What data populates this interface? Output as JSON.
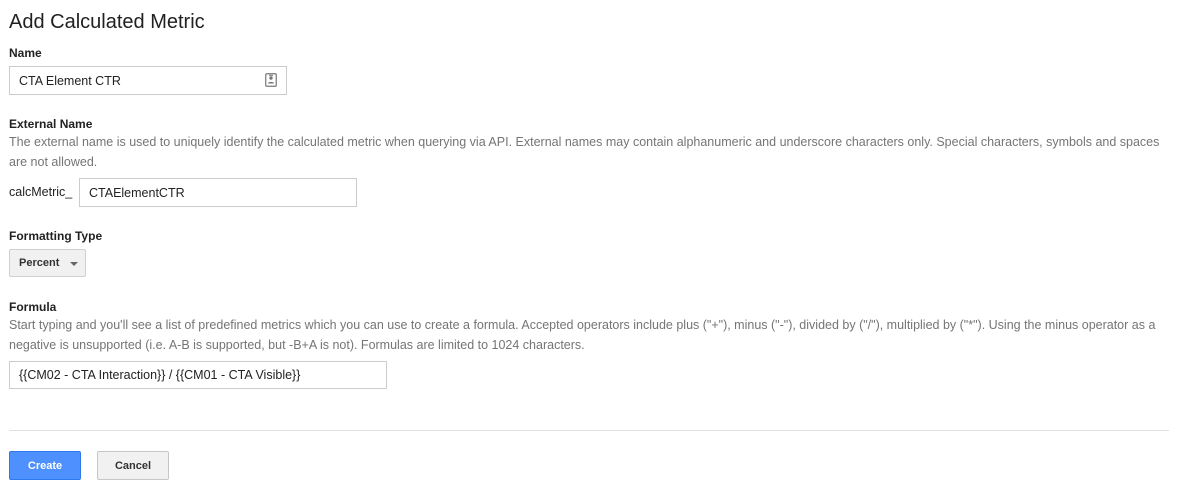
{
  "page": {
    "title": "Add Calculated Metric"
  },
  "name_field": {
    "label": "Name",
    "value": "CTA Element CTR",
    "icon": "contact-card-icon"
  },
  "external_name": {
    "label": "External Name",
    "help": "The external name is used to uniquely identify the calculated metric when querying via API. External names may contain alphanumeric and underscore characters only. Special characters, symbols and spaces are not allowed.",
    "prefix": "calcMetric_",
    "value": "CTAElementCTR"
  },
  "formatting_type": {
    "label": "Formatting Type",
    "selected": "Percent"
  },
  "formula": {
    "label": "Formula",
    "help": "Start typing and you'll see a list of predefined metrics which you can use to create a formula. Accepted operators include plus (\"+\"), minus (\"-\"), divided by (\"/\"), multiplied by (\"*\"). Using the minus operator as a negative is unsupported (i.e. A-B is supported, but -B+A is not). Formulas are limited to 1024 characters.",
    "value": "{{CM02 - CTA Interaction}} / {{CM01 - CTA Visible}}"
  },
  "actions": {
    "create_label": "Create",
    "cancel_label": "Cancel"
  },
  "colors": {
    "primary_button": "#4d90fe",
    "help_text": "#757575",
    "border": "#cccccc"
  }
}
